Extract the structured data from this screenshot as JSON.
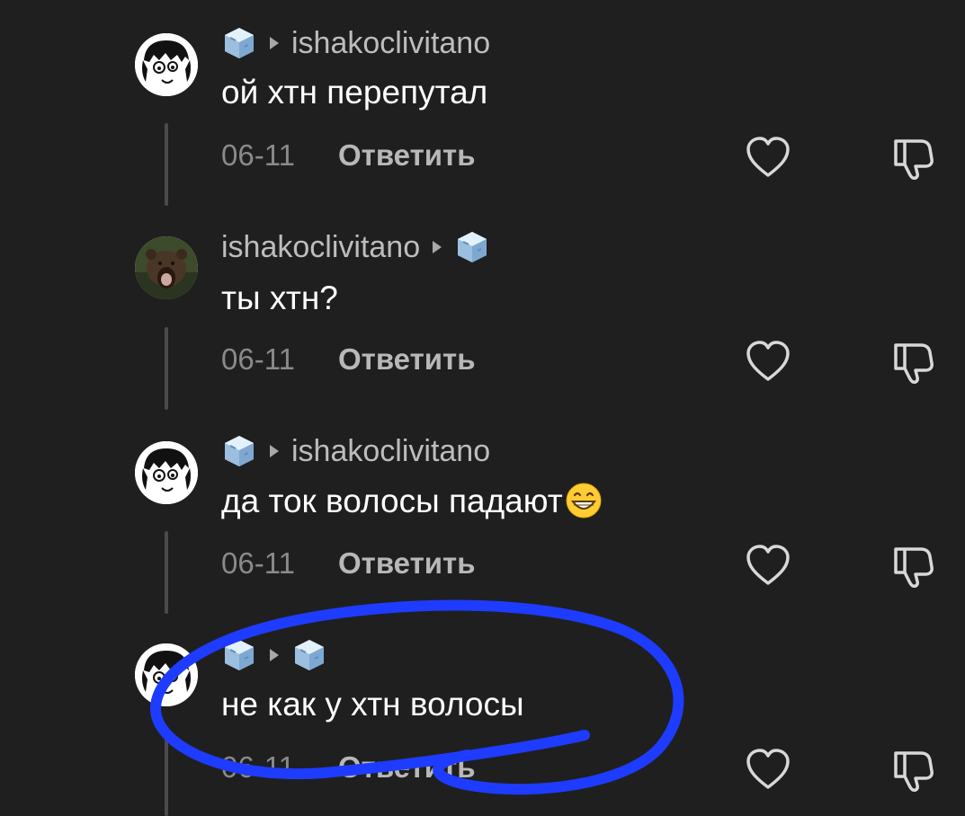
{
  "comments": [
    {
      "author": "ishakoclivitano",
      "name_order": "icon-first",
      "avatar": "sketch-face-avatar",
      "text": "ой хтн перепутал",
      "date": "06-11",
      "reply_label": "Ответить"
    },
    {
      "author": "ishakoclivitano",
      "name_order": "name-first",
      "avatar": "bear-avatar",
      "text": "ты хтн?",
      "date": "06-11",
      "reply_label": "Ответить"
    },
    {
      "author": "ishakoclivitano",
      "name_order": "icon-first",
      "avatar": "sketch-face-avatar",
      "text": "да ток волосы падают",
      "emoji": "grinning-emoji",
      "date": "06-11",
      "reply_label": "Ответить"
    },
    {
      "author": "",
      "name_order": "icon-only",
      "avatar": "sketch-face-avatar",
      "text": "не как у хтн волосы",
      "date": "06-11",
      "reply_label": "Ответить"
    }
  ],
  "icons": {
    "like": "heart-icon",
    "dislike": "thumbs-down-icon",
    "separator": "triangle-arrow-icon",
    "user_badge": "ice-cube-icon"
  },
  "colors": {
    "background": "#1f1f1f",
    "text": "#ffffff",
    "username": "#bdbdbd",
    "date": "#8a8a8a",
    "reply": "#b8b8b8",
    "annotation": "#1e3cff"
  }
}
